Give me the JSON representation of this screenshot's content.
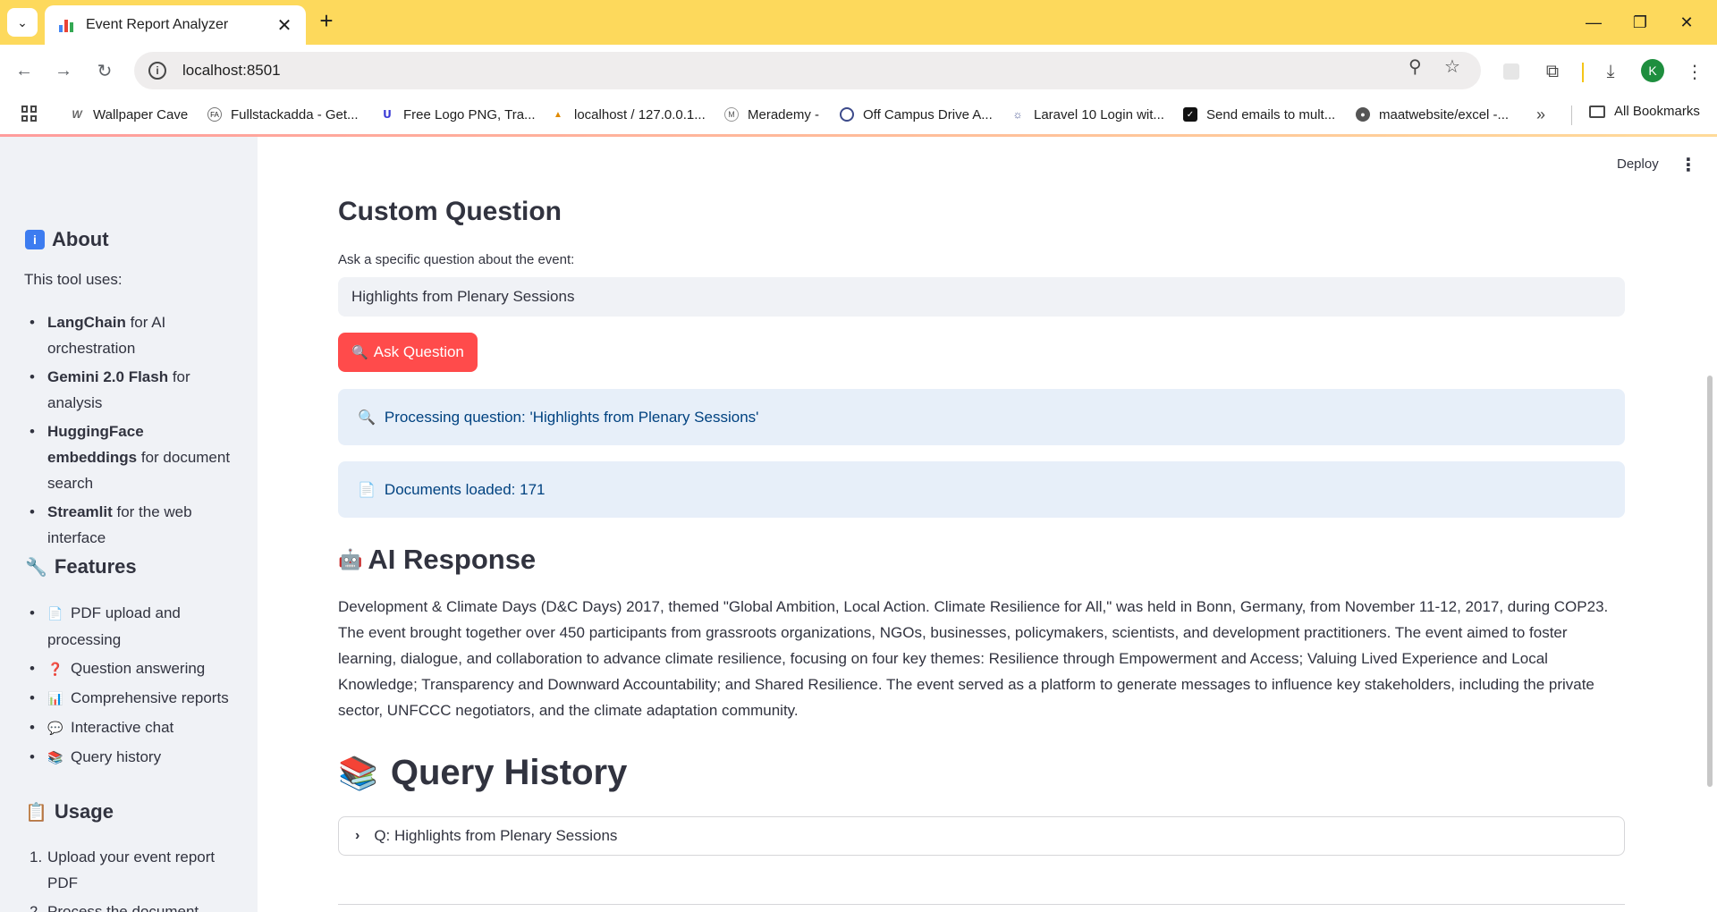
{
  "browser": {
    "tab_title": "Event Report Analyzer",
    "url": "localhost:8501",
    "profile_initial": "K",
    "bookmarks": [
      {
        "label": "Wallpaper Cave"
      },
      {
        "label": "Fullstackadda - Get..."
      },
      {
        "label": "Free Logo PNG, Tra..."
      },
      {
        "label": "localhost / 127.0.0.1..."
      },
      {
        "label": "Merademy -"
      },
      {
        "label": "Off Campus Drive A..."
      },
      {
        "label": "Laravel 10 Login wit..."
      },
      {
        "label": "Send emails to mult..."
      },
      {
        "label": "maatwebsite/excel -..."
      }
    ],
    "all_bookmarks": "All Bookmarks"
  },
  "app": {
    "deploy_label": "Deploy"
  },
  "sidebar": {
    "about_title": "About",
    "about_intro": "This tool uses:",
    "about_items": [
      {
        "bold": "LangChain",
        "text": " for AI orchestration"
      },
      {
        "bold": "Gemini 2.0 Flash",
        "text": " for analysis"
      },
      {
        "bold": "HuggingFace embeddings",
        "text": " for document search"
      },
      {
        "bold": "Streamlit",
        "text": " for the web interface"
      }
    ],
    "features_title": "Features",
    "features": [
      {
        "icon": "📄",
        "label": "PDF upload and processing"
      },
      {
        "icon": "❓",
        "label": "Question answering"
      },
      {
        "icon": "📊",
        "label": "Comprehensive reports"
      },
      {
        "icon": "💬",
        "label": "Interactive chat"
      },
      {
        "icon": "📚",
        "label": "Query history"
      }
    ],
    "usage_title": "Usage",
    "usage": [
      {
        "n": "1.",
        "label": "Upload your event report PDF"
      },
      {
        "n": "2.",
        "label": "Process the document"
      }
    ]
  },
  "main": {
    "custom_title": "Custom Question",
    "question_label": "Ask a specific question about the event:",
    "question_value": "Highlights from Plenary Sessions",
    "ask_button": "Ask Question",
    "processing_msg": "Processing question: 'Highlights from Plenary Sessions'",
    "docs_loaded_msg": "Documents loaded: 171",
    "ai_title": "AI Response",
    "ai_response": "Development & Climate Days (D&C Days) 2017, themed \"Global Ambition, Local Action. Climate Resilience for All,\" was held in Bonn, Germany, from November 11-12, 2017, during COP23. The event brought together over 450 participants from grassroots organizations, NGOs, businesses, policymakers, scientists, and development practitioners. The event aimed to foster learning, dialogue, and collaboration to advance climate resilience, focusing on four key themes: Resilience through Empowerment and Access; Valuing Lived Experience and Local Knowledge; Transparency and Downward Accountability; and Shared Resilience. The event served as a platform to generate messages to influence key stakeholders, including the private sector, UNFCCC negotiators, and the climate adaptation community.",
    "history_title": "Query History",
    "history_items": [
      {
        "label": "Q: Highlights from Plenary Sessions"
      }
    ]
  }
}
